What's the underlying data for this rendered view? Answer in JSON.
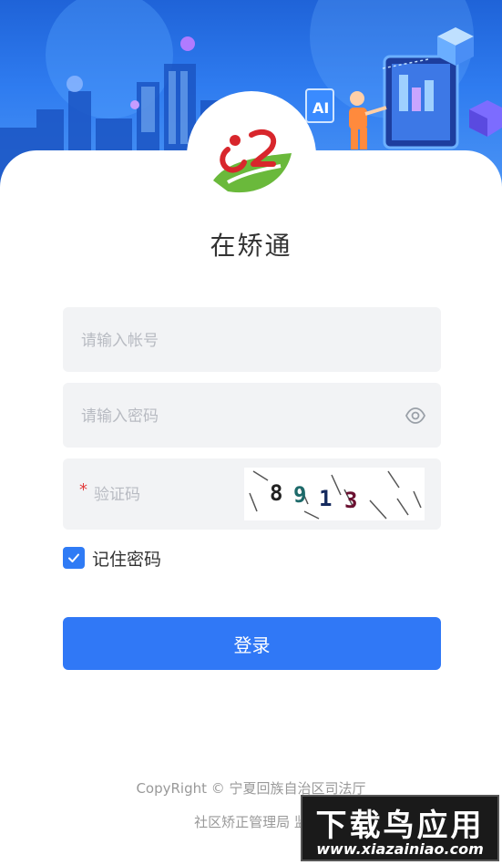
{
  "app": {
    "title": "在矫通"
  },
  "form": {
    "username_placeholder": "请输入帐号",
    "password_placeholder": "请输入密码",
    "captcha_required_mark": "*",
    "captcha_placeholder": "验证码",
    "captcha_digits": [
      "8",
      "9",
      "1",
      "3"
    ],
    "remember_label": "记住密码",
    "remember_checked": true,
    "login_label": "登录"
  },
  "footer": {
    "copyright": "CopyRight © 宁夏回族自治区司法厅",
    "department": "社区矫正管理局 监"
  },
  "watermark": {
    "main": "下载鸟应用",
    "sub": "www.xiazainiao.com"
  },
  "colors": {
    "accent": "#3078f6",
    "field_bg": "#f2f3f5",
    "required": "#e23b3b"
  },
  "icons": {
    "password_toggle": "eye-icon",
    "checkbox": "check-icon",
    "logo": "app-logo"
  }
}
